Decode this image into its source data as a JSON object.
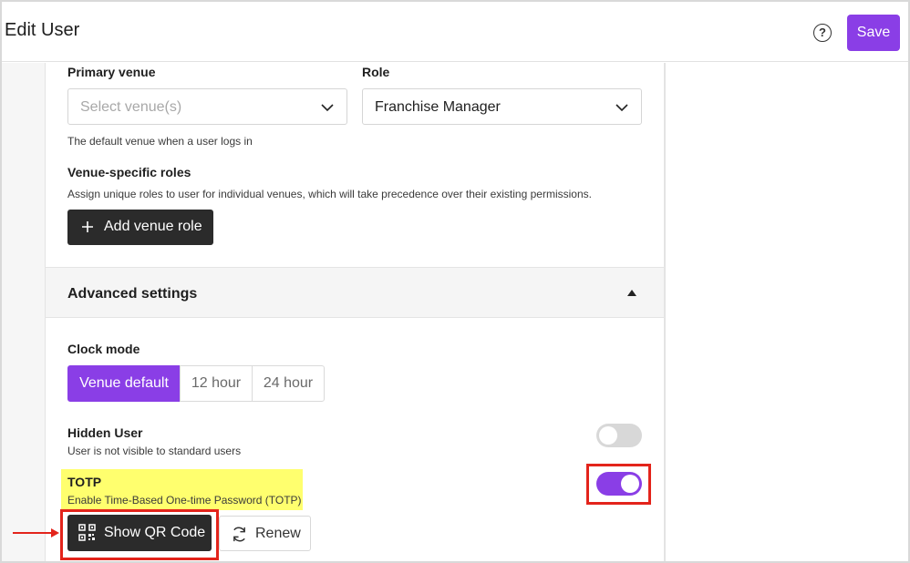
{
  "header": {
    "title": "Edit User",
    "help_glyph": "?",
    "save_label": "Save"
  },
  "form": {
    "primary_venue": {
      "label": "Primary venue",
      "placeholder": "Select venue(s)",
      "help": "The default venue when a user logs in"
    },
    "role": {
      "label": "Role",
      "value": "Franchise Manager"
    },
    "venue_roles": {
      "label": "Venue-specific roles",
      "help": "Assign unique roles to user for individual venues, which will take precedence over their existing permissions.",
      "add_label": "Add venue role"
    }
  },
  "advanced": {
    "title": "Advanced settings",
    "clock_mode": {
      "label": "Clock mode",
      "options": [
        "Venue default",
        "12 hour",
        "24 hour"
      ],
      "selected": "Venue default"
    },
    "hidden_user": {
      "label": "Hidden User",
      "help": "User is not visible to standard users",
      "enabled": false
    },
    "totp": {
      "label": "TOTP",
      "help": "Enable Time-Based One-time Password (TOTP)",
      "enabled": true
    },
    "show_qr_label": "Show QR Code",
    "renew_label": "Renew"
  },
  "colors": {
    "accent": "#8a3ee6",
    "annotation": "#e3241b",
    "highlight": "#ffff6e",
    "dark_button": "#2b2b2b"
  },
  "icons": [
    "help-icon",
    "chevron-down-icon",
    "plus-icon",
    "caret-up-icon",
    "qr-code-icon",
    "refresh-icon",
    "arrow-right-icon"
  ]
}
